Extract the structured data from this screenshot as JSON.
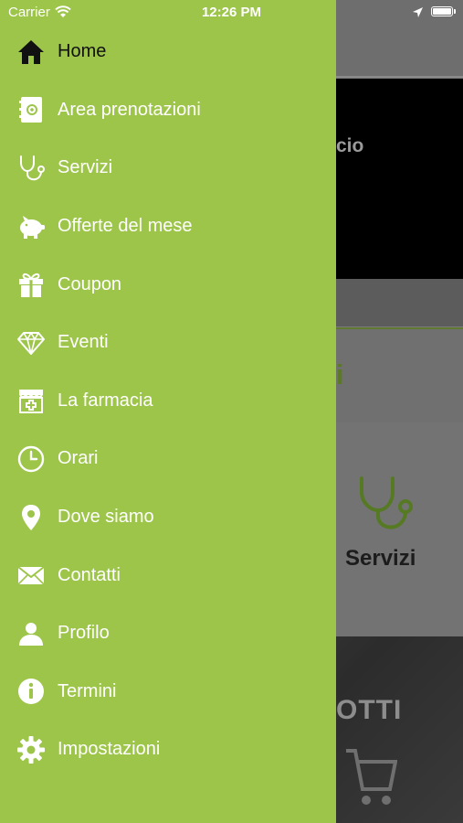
{
  "status_bar": {
    "carrier": "Carrier",
    "time": "12:26 PM"
  },
  "menu": {
    "items": [
      {
        "label": "Home",
        "icon": "home-icon",
        "active": true
      },
      {
        "label": "Area prenotazioni",
        "icon": "booking-book-icon"
      },
      {
        "label": "Servizi",
        "icon": "stethoscope-icon"
      },
      {
        "label": "Offerte del mese",
        "icon": "piggy-bank-icon"
      },
      {
        "label": "Coupon",
        "icon": "gift-icon"
      },
      {
        "label": "Eventi",
        "icon": "diamond-icon"
      },
      {
        "label": "La farmacia",
        "icon": "pharmacy-store-icon"
      },
      {
        "label": "Orari",
        "icon": "clock-icon"
      },
      {
        "label": "Dove siamo",
        "icon": "map-pin-icon"
      },
      {
        "label": "Contatti",
        "icon": "envelope-icon"
      },
      {
        "label": "Profilo",
        "icon": "user-icon"
      },
      {
        "label": "Termini",
        "icon": "info-icon"
      },
      {
        "label": "Impostazioni",
        "icon": "gear-icon"
      }
    ]
  },
  "background": {
    "hero_text": "cio",
    "section_title": "oni",
    "tile_label": "Servizi",
    "bottom_text": "OTTI"
  },
  "colors": {
    "drawer": "#9dc54a",
    "active_label": "#111111",
    "menu_text": "#ffffff"
  }
}
